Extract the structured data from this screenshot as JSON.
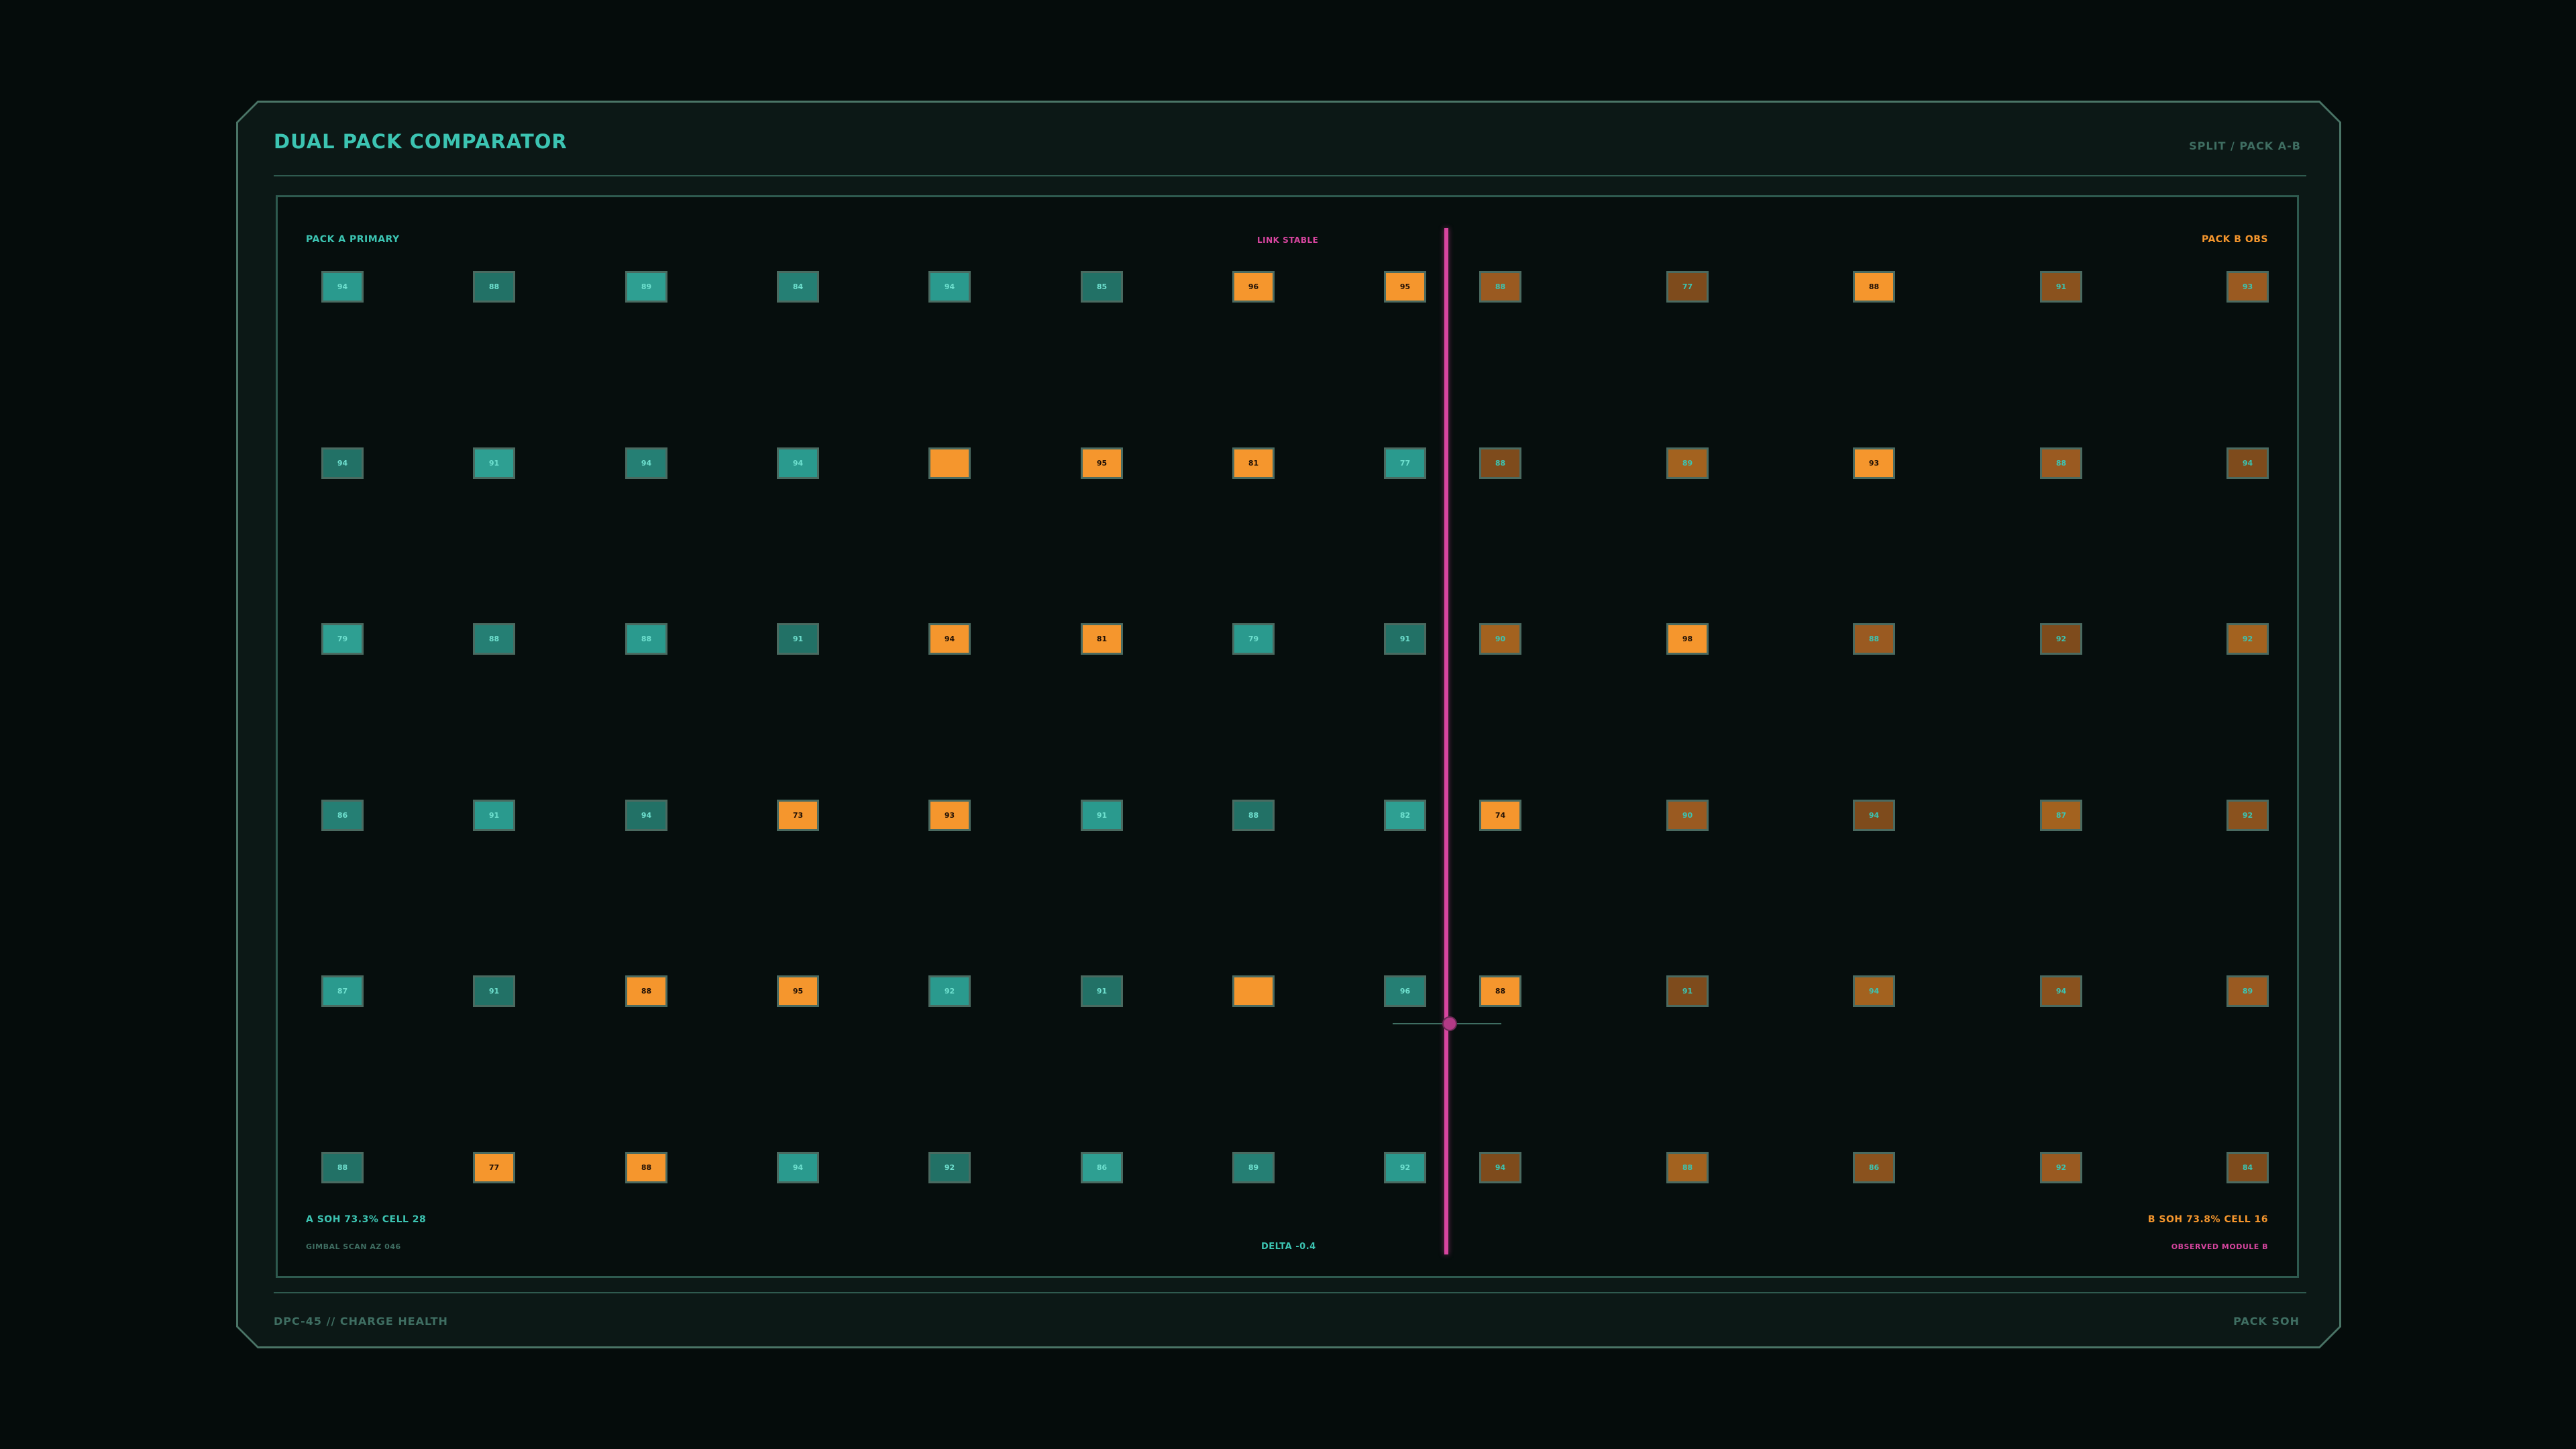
{
  "header": {
    "title": "DUAL PACK COMPARATOR",
    "mode": "SPLIT  /  PACK A-B"
  },
  "footer": {
    "left": "DPC-45  //  CHARGE HEALTH",
    "right": "PACK SOH"
  },
  "colors": {
    "accent_teal": "#3cc4b2",
    "accent_orange": "#f5962d",
    "link_magenta": "#d7459f",
    "tile_border": "#4a6a60"
  },
  "link_status": "LINK STABLE",
  "pack_a": {
    "label": "PACK A  PRIMARY",
    "summary": "A SOH 73.3% CELL 28",
    "gimbal": "GIMBAL SCAN AZ 046",
    "rows": [
      [
        "94",
        "88",
        "89",
        "84",
        "94",
        "85",
        "96",
        "95"
      ],
      [
        "94",
        "91",
        "94",
        "94",
        "",
        "95",
        "81",
        "77"
      ],
      [
        "79",
        "88",
        "88",
        "91",
        "94",
        "81",
        "79",
        "91"
      ],
      [
        "86",
        "91",
        "94",
        "73",
        "93",
        "91",
        "88",
        "82"
      ],
      [
        "87",
        "91",
        "88",
        "95",
        "92",
        "91",
        "",
        "96"
      ],
      [
        "88",
        "77",
        "88",
        "94",
        "92",
        "86",
        "89",
        "92"
      ]
    ],
    "highlights": [
      [
        0,
        0,
        0,
        0,
        0,
        0,
        1,
        1
      ],
      [
        0,
        0,
        0,
        0,
        1,
        1,
        1,
        0
      ],
      [
        0,
        0,
        0,
        0,
        1,
        1,
        0,
        0
      ],
      [
        0,
        0,
        0,
        1,
        1,
        0,
        0,
        0
      ],
      [
        0,
        0,
        1,
        1,
        0,
        0,
        1,
        0
      ],
      [
        0,
        1,
        1,
        0,
        0,
        0,
        0,
        0
      ]
    ]
  },
  "pack_b": {
    "label": "PACK B  OBS",
    "summary": "B SOH 73.8% CELL 16",
    "observed": "OBSERVED MODULE B",
    "rows": [
      [
        "88",
        "77",
        "88",
        "91",
        "93"
      ],
      [
        "88",
        "89",
        "93",
        "88",
        "94"
      ],
      [
        "90",
        "98",
        "88",
        "92",
        "92"
      ],
      [
        "74",
        "90",
        "94",
        "87",
        "92"
      ],
      [
        "88",
        "91",
        "94",
        "94",
        "89"
      ],
      [
        "94",
        "88",
        "86",
        "92",
        "84"
      ]
    ],
    "highlights": [
      [
        0,
        0,
        1,
        0,
        0
      ],
      [
        0,
        0,
        1,
        0,
        0
      ],
      [
        0,
        1,
        0,
        0,
        0
      ],
      [
        1,
        0,
        0,
        0,
        0
      ],
      [
        1,
        0,
        0,
        0,
        0
      ],
      [
        0,
        0,
        0,
        0,
        0
      ]
    ]
  },
  "delta": "DELTA  -0.4"
}
